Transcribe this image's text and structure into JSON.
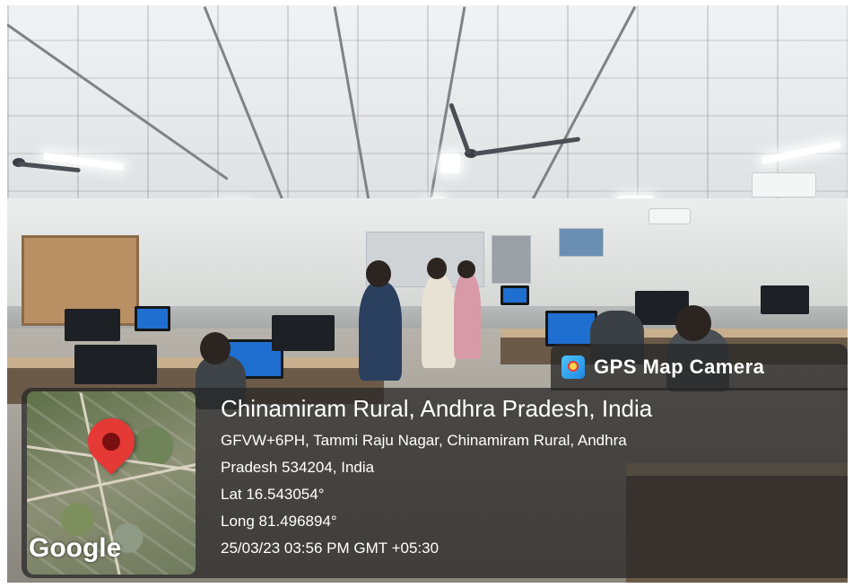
{
  "badge": {
    "icon": "gps-map-camera-icon",
    "label": "GPS Map Camera"
  },
  "location": {
    "title": "Chinamiram Rural, Andhra Pradesh, India",
    "address_line_1": "GFVW+6PH, Tammi Raju Nagar, Chinamiram Rural, Andhra",
    "address_line_2": "Pradesh 534204, India",
    "latitude": "Lat 16.543054°",
    "longitude": "Long 81.496894°",
    "datetime": "25/03/23 03:56 PM GMT +05:30"
  },
  "map": {
    "icon": "map-pin-icon",
    "provider_logo": "Google"
  },
  "colors": {
    "overlay": "#262626",
    "pin": "#e53935",
    "text": "#ffffff"
  }
}
